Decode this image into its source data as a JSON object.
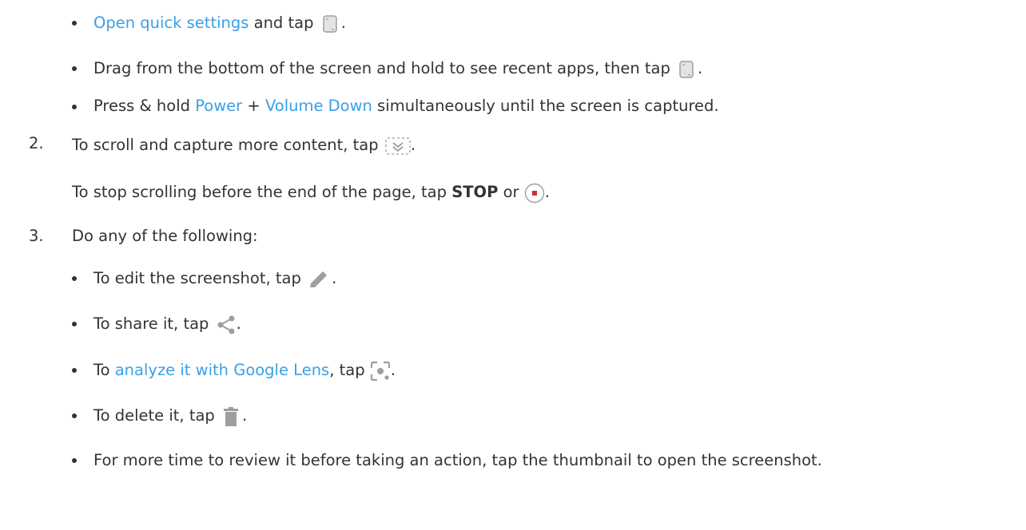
{
  "step1_options": [
    {
      "link": "Open quick settings",
      "text_after_link": " and tap ",
      "end": ".",
      "icon": "screenshot-icon"
    },
    {
      "text": "Drag from the bottom of the screen and hold to see recent apps, then tap ",
      "end": ".",
      "icon": "screenshot-icon"
    },
    {
      "text_before": "Press & hold ",
      "link_power": "Power",
      "plus": " + ",
      "link_volume": "Volume Down",
      "text_after": " simultaneously until the screen is captured."
    }
  ],
  "step2": {
    "number": "2.",
    "text": "To scroll and capture more content, tap ",
    "end": ".",
    "icon": "scroll-capture-icon",
    "stop_text_before": "To stop scrolling before the end of the page, tap ",
    "stop_bold": "STOP",
    "stop_or": " or ",
    "stop_end": ".",
    "stop_icon": "stop-record-icon"
  },
  "step3": {
    "number": "3.",
    "text": "Do any of the following:",
    "options": [
      {
        "text": "To edit the screenshot, tap ",
        "end": ".",
        "icon": "edit-pencil-icon"
      },
      {
        "text": "To share it, tap ",
        "end": ".",
        "icon": "share-icon"
      },
      {
        "text_before": "To ",
        "link": "analyze it with Google Lens",
        "text_after": ", tap ",
        "end": ".",
        "icon": "google-lens-icon"
      },
      {
        "text": "To delete it, tap ",
        "end": ".",
        "icon": "trash-icon"
      },
      {
        "text": "For more time to review it before taking an action, tap the thumbnail to open the screenshot."
      }
    ]
  },
  "colors": {
    "link": "#3aa0e6",
    "text": "#333333",
    "icon_gray": "#9e9e9e",
    "stop_red": "#d32f2f"
  }
}
